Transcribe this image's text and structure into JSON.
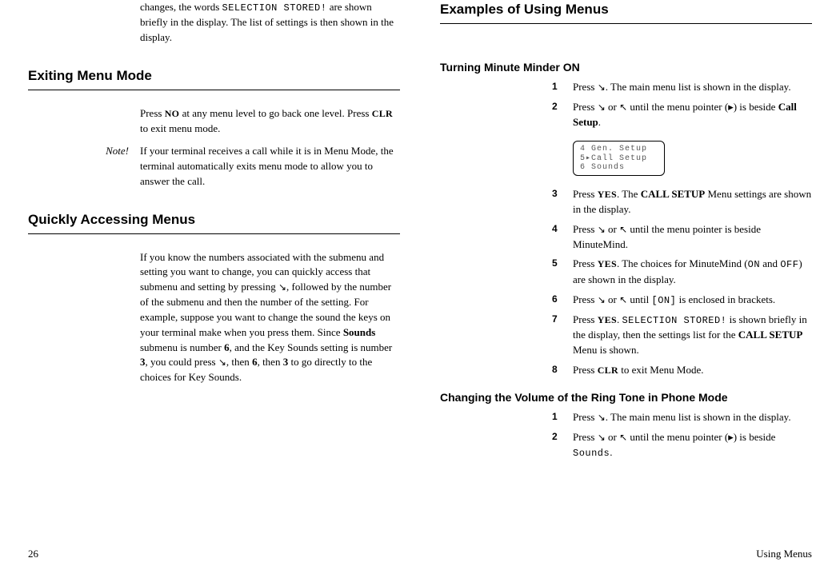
{
  "leftCol": {
    "introTailA": "changes, the words ",
    "introTailMono": "SELECTION STORED!",
    "introTailB": " are shown briefly in the display.  The list of settings is then shown in the display.",
    "h_exit": "Exiting Menu Mode",
    "exit_a": "Press ",
    "exit_no": "NO",
    "exit_b": " at any menu level to go back one level.  Press ",
    "exit_clr": "CLR",
    "exit_c": " to exit menu mode.",
    "noteLabel": "Note!",
    "noteText": "If your terminal receives a call while it is in Menu Mode, the terminal automatically exits menu mode to allow you to answer the call.",
    "h_quick": "Quickly Accessing Menus",
    "quick_a": "If you know the numbers associated with the submenu and setting you want to change, you can quickly access that submenu and setting by pressing ",
    "quick_b": ", followed by the number of the submenu and then the number of the setting.  For example, suppose you want to change the sound the keys on your terminal make when you press them.  Since ",
    "quick_sounds": "Sounds",
    "quick_c": " submenu is number ",
    "quick_6a": "6",
    "quick_d": ", and the Key Sounds setting is number ",
    "quick_3a": "3",
    "quick_e": ", you could press ",
    "quick_f": ", then ",
    "quick_6b": "6",
    "quick_g": ", then ",
    "quick_3b": "3",
    "quick_h": " to go directly to the choices for Key Sounds."
  },
  "rightCol": {
    "h_examples": "Examples of Using Menus",
    "h_minute": "Turning Minute Minder ON",
    "s1_1a": "Press ",
    "s1_1b": ".  The main menu list is shown in the display.",
    "s1_2a": "Press ",
    "s1_2b": " or ",
    "s1_2c": " until the menu pointer (",
    "s1_2d": ") is beside ",
    "s1_2e": "Call Setup",
    "s1_2f": ".",
    "lcd1": "4 Gen. Setup",
    "lcd2": "5▸Call Setup",
    "lcd3": "6 Sounds",
    "s1_3a": "Press ",
    "s1_3yes": "YES",
    "s1_3b": ".  The ",
    "s1_3bold": "CALL SETUP",
    "s1_3c": " Menu settings are shown in the display.",
    "s1_4a": "Press ",
    "s1_4b": " or ",
    "s1_4c": " until the menu pointer is beside MinuteMind.",
    "s1_5a": "Press ",
    "s1_5b": ".  The choices for MinuteMind (",
    "s1_5on": "ON",
    "s1_5c": "  and ",
    "s1_5off": "OFF",
    "s1_5d": ") are shown in the display.",
    "s1_6a": "Press ",
    "s1_6b": " or ",
    "s1_6c": " until ",
    "s1_6on": "[ON]",
    "s1_6d": " is enclosed in brackets.",
    "s1_7a": "Press ",
    "s1_7b": ".  ",
    "s1_7mono": "SELECTION STORED!",
    "s1_7c": " is shown briefly in the display, then the settings list for the ",
    "s1_7bold": "CALL SETUP",
    "s1_7d": " Menu is shown.",
    "s1_8a": "Press ",
    "s1_8clr": "CLR",
    "s1_8b": " to exit Menu Mode.",
    "h_volume": "Changing the Volume of the Ring Tone in Phone Mode",
    "s2_1a": "Press ",
    "s2_1b": ".  The main menu list is shown in the display.",
    "s2_2a": "Press ",
    "s2_2b": " or ",
    "s2_2c": " until the menu pointer (",
    "s2_2d": ") is beside ",
    "s2_2sounds": "Sounds",
    "s2_2e": "."
  },
  "nums": {
    "n1": "1",
    "n2": "2",
    "n3": "3",
    "n4": "4",
    "n5": "5",
    "n6": "6",
    "n7": "7",
    "n8": "8"
  },
  "icons": {
    "downRight": "↘",
    "upLeft": "↖",
    "pointer": "▸"
  },
  "footer": {
    "pageNum": "26",
    "section": "Using Menus"
  }
}
